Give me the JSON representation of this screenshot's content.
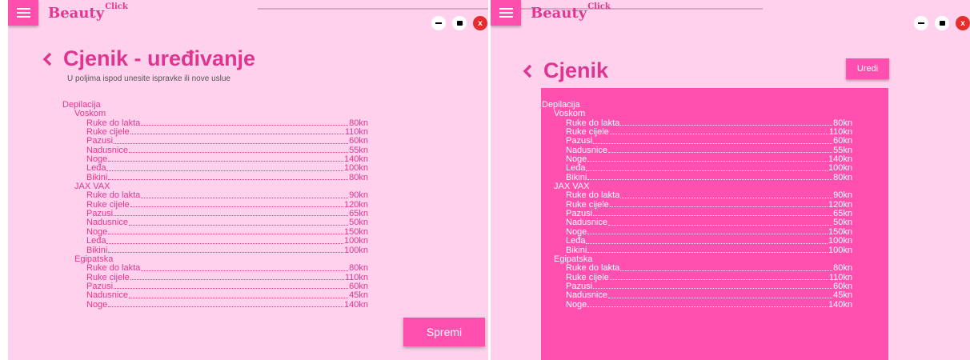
{
  "app": {
    "logo_text": "Beauty",
    "logo_sup": "Click"
  },
  "window_controls": {
    "close_label": "x"
  },
  "left": {
    "title": "Cjenik - uređivanje",
    "subtitle": "U poljima ispod unesite ispravke ili nove uslue",
    "save_label": "Spremi",
    "list": [
      {
        "category": "Depilacija",
        "groups": [
          {
            "name": "Voskom",
            "items": [
              {
                "name": "Ruke do lakta",
                "price": "80kn"
              },
              {
                "name": "Ruke cijele",
                "price": "110kn"
              },
              {
                "name": "Pazusi",
                "price": "60kn"
              },
              {
                "name": "Nadusnice",
                "price": "55kn"
              },
              {
                "name": "Noge",
                "price": "140kn"
              },
              {
                "name": "Leđa",
                "price": "100kn"
              },
              {
                "name": "Bikini",
                "price": "80kn"
              }
            ]
          },
          {
            "name": "JAX VAX",
            "items": [
              {
                "name": "Ruke do lakta",
                "price": "90kn"
              },
              {
                "name": "Ruke cijele",
                "price": "120kn"
              },
              {
                "name": "Pazusi",
                "price": "65kn"
              },
              {
                "name": "Nadusnice",
                "price": "50kn"
              },
              {
                "name": "Noge",
                "price": "150kn"
              },
              {
                "name": "Leđa",
                "price": "100kn"
              },
              {
                "name": "Bikini",
                "price": "100kn"
              }
            ]
          },
          {
            "name": "Egipatska",
            "items": [
              {
                "name": "Ruke do lakta",
                "price": "80kn"
              },
              {
                "name": "Ruke cijele",
                "price": "110kn"
              },
              {
                "name": "Pazusi",
                "price": "60kn"
              },
              {
                "name": "Nadusnice",
                "price": "45kn"
              },
              {
                "name": "Noge",
                "price": "140kn"
              }
            ]
          }
        ]
      }
    ]
  },
  "right": {
    "title": "Cjenik",
    "edit_label": "Uredi",
    "list": [
      {
        "category": "Depilacija",
        "groups": [
          {
            "name": "Voskom",
            "items": [
              {
                "name": "Ruke do lakta",
                "price": "80kn"
              },
              {
                "name": "Ruke cijele",
                "price": "110kn"
              },
              {
                "name": "Pazusi",
                "price": "60kn"
              },
              {
                "name": "Nadusnice",
                "price": "55kn"
              },
              {
                "name": "Noge",
                "price": "140kn"
              },
              {
                "name": "Leđa",
                "price": "100kn"
              },
              {
                "name": "Bikini",
                "price": "80kn"
              }
            ]
          },
          {
            "name": "JAX VAX",
            "items": [
              {
                "name": "Ruke do lakta",
                "price": "90kn"
              },
              {
                "name": "Ruke cijele",
                "price": "120kn"
              },
              {
                "name": "Pazusi",
                "price": "65kn"
              },
              {
                "name": "Nadusnice",
                "price": "50kn"
              },
              {
                "name": "Noge",
                "price": "150kn"
              },
              {
                "name": "Leđa",
                "price": "100kn"
              },
              {
                "name": "Bikini",
                "price": "100kn"
              }
            ]
          },
          {
            "name": "Egipatska",
            "items": [
              {
                "name": "Ruke do lakta",
                "price": "80kn"
              },
              {
                "name": "Ruke cijele",
                "price": "110kn"
              },
              {
                "name": "Pazusi",
                "price": "60kn"
              },
              {
                "name": "Nadusnice",
                "price": "45kn"
              },
              {
                "name": "Noge",
                "price": "140kn"
              }
            ]
          }
        ]
      }
    ]
  },
  "colors": {
    "background": "#ffd1ec",
    "accent": "#ff4faf",
    "text_pink": "#e0378f"
  }
}
